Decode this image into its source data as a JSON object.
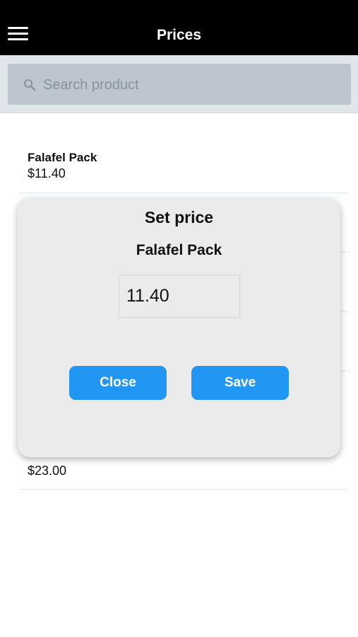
{
  "header": {
    "title": "Prices",
    "menu_icon": "hamburger-menu-icon"
  },
  "search": {
    "placeholder": "Search product",
    "value": "",
    "icon": "search-icon"
  },
  "products": [
    {
      "name": "Falafel Pack",
      "price": "$11.40"
    },
    {
      "name": "",
      "price": ""
    },
    {
      "name": "",
      "price": ""
    },
    {
      "name": "",
      "price": ""
    },
    {
      "name": "",
      "price": "$23.00"
    }
  ],
  "dialog": {
    "title": "Set price",
    "product_name": "Falafel Pack",
    "price_value": "11.40",
    "close_label": "Close",
    "save_label": "Save"
  },
  "colors": {
    "header_bg": "#000000",
    "search_bar_bg": "#e1e6ea",
    "search_box_bg": "#bdc6cf",
    "dialog_bg": "#ebebeb",
    "button_bg": "#2196f3"
  }
}
